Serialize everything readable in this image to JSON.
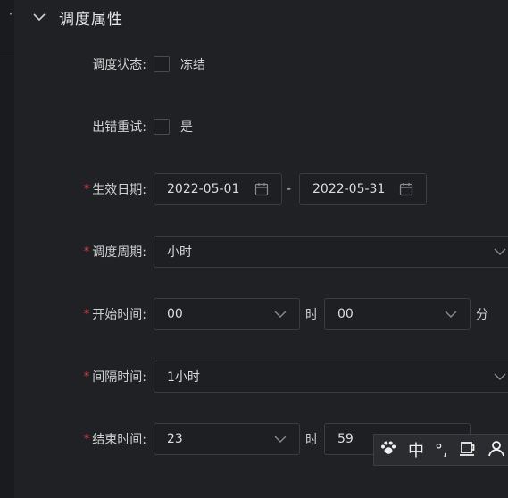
{
  "section": {
    "title": "调度属性",
    "expanded_icon": "chevron-down-icon"
  },
  "fields": {
    "status": {
      "label": "调度状态:",
      "option": "冻结",
      "checked": false
    },
    "retry": {
      "label": "出错重试:",
      "option": "是",
      "checked": false
    },
    "effective_date": {
      "label": "生效日期:",
      "required": true,
      "start": "2022-05-01",
      "end": "2022-05-31",
      "separator": "-"
    },
    "cycle": {
      "label": "调度周期:",
      "required": true,
      "value": "小时"
    },
    "start_time": {
      "label": "开始时间:",
      "required": true,
      "hour": "00",
      "hour_unit": "时",
      "minute": "00",
      "minute_unit": "分"
    },
    "interval": {
      "label": "间隔时间:",
      "required": true,
      "value": "1小时"
    },
    "end_time": {
      "label": "结束时间:",
      "required": true,
      "hour": "23",
      "hour_unit": "时",
      "minute": "59"
    }
  },
  "ime_toolbar": {
    "lang": "中",
    "punct": "°,",
    "icons": [
      "paw-icon",
      "punctuation-icon",
      "mug-icon",
      "user-icon"
    ]
  },
  "colors": {
    "background": "#202124",
    "required": "#e0424b",
    "border": "#3b3c41"
  }
}
